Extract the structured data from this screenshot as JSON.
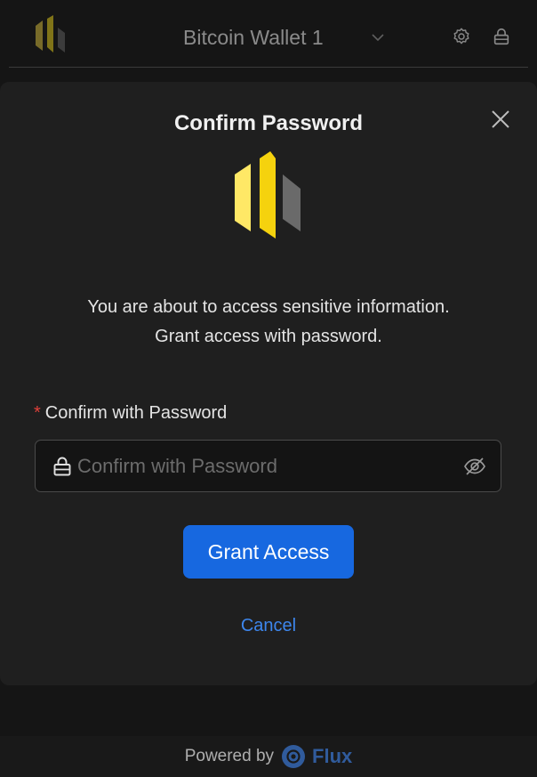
{
  "header": {
    "wallet_name": "Bitcoin Wallet 1",
    "icons": [
      "app-logo",
      "chevron-down-icon",
      "gear-icon",
      "lock-icon"
    ]
  },
  "modal": {
    "title": "Confirm Password",
    "message_line1": "You are about to access sensitive information.",
    "message_line2": "Grant access with password.",
    "field": {
      "required_marker": "*",
      "label": "Confirm with Password",
      "placeholder": "Confirm with Password",
      "value": ""
    },
    "grant_label": "Grant Access",
    "cancel_label": "Cancel"
  },
  "footer": {
    "powered_by": "Powered by",
    "brand": "Flux"
  },
  "colors": {
    "accent": "#1768e0",
    "link": "#3d86ec",
    "logo_yellow": "#f5d20e",
    "logo_light_yellow": "#ffe866",
    "logo_gray": "#6a6a6a",
    "required": "#e0413b"
  }
}
